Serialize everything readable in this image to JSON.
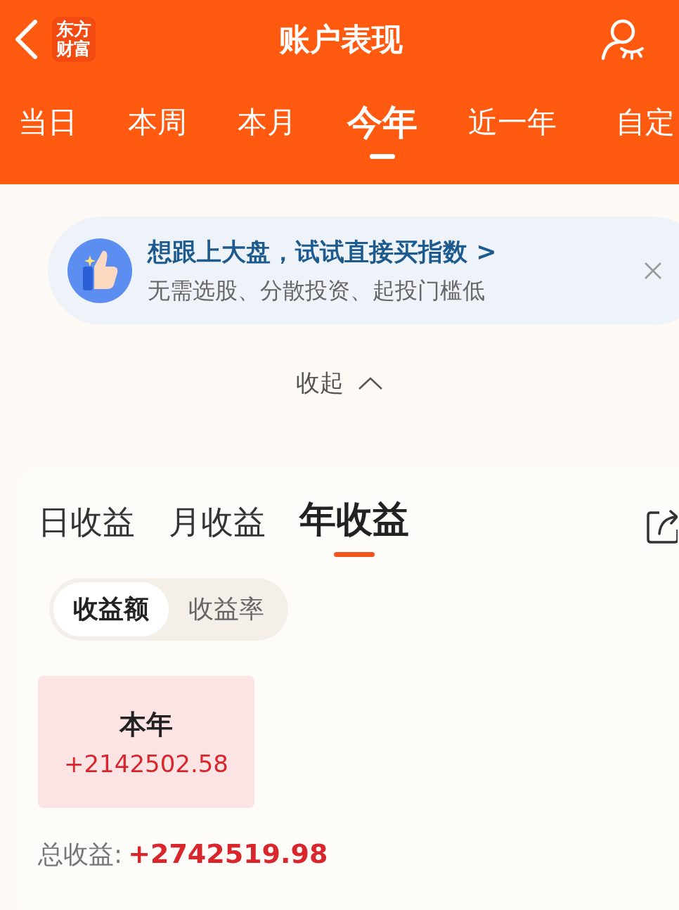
{
  "header": {
    "logo": [
      "东方",
      "财富"
    ],
    "title": "账户表现"
  },
  "period_tabs": [
    {
      "label": "当日",
      "selected": false
    },
    {
      "label": "本周",
      "selected": false
    },
    {
      "label": "本月",
      "selected": false
    },
    {
      "label": "今年",
      "selected": true
    },
    {
      "label": "近一年",
      "selected": false
    },
    {
      "label": "自定",
      "selected": false
    }
  ],
  "promo": {
    "title": "想跟上大盘，试试直接买指数 >",
    "subtitle": "无需选股、分散投资、起投门槛低"
  },
  "collapse": {
    "label": "收起"
  },
  "profit_tabs": [
    {
      "label": "日收益",
      "selected": false
    },
    {
      "label": "月收益",
      "selected": false
    },
    {
      "label": "年收益",
      "selected": true
    }
  ],
  "segments": [
    {
      "label": "收益额",
      "selected": true
    },
    {
      "label": "收益率",
      "selected": false
    }
  ],
  "year_cells": [
    {
      "label": "本年",
      "value": "+2142502.58"
    }
  ],
  "total": {
    "label": "总收益:",
    "value": "+2742519.98"
  }
}
